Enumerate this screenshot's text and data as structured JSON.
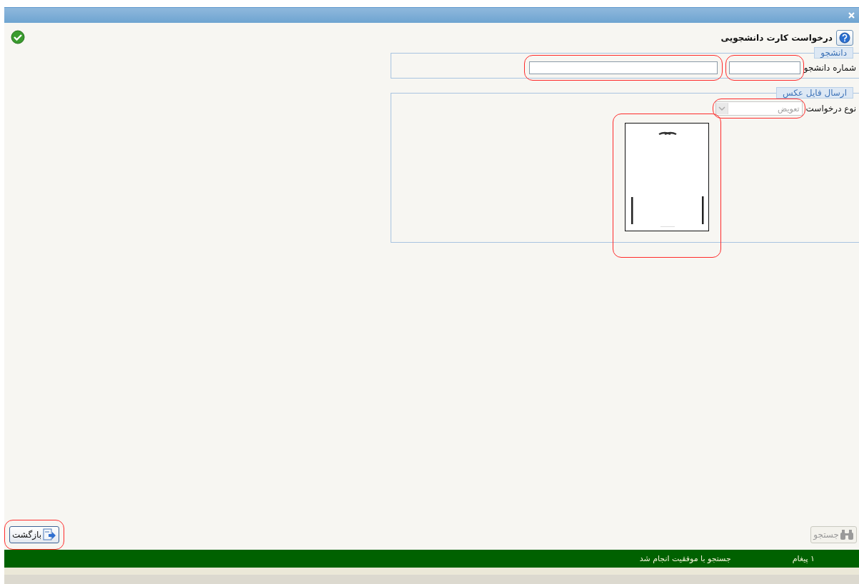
{
  "page_title": "درخواست کارت دانشجویی",
  "student_section": {
    "legend": "دانشجو",
    "label": "شماره دانشجو",
    "number_field": {
      "highlighted": true
    },
    "name_field": {
      "highlighted": true
    }
  },
  "photo_section": {
    "legend": "ارسال فایل عکس",
    "request_type": {
      "label": "نوع درخواست",
      "value": "تعویض",
      "disabled": true,
      "highlighted": true
    },
    "photo": {
      "kind": "picture",
      "highlighted": true
    }
  },
  "buttons": [
    {
      "kind": "search",
      "label": "جستجو",
      "disabled": true,
      "highlighted": false
    },
    {
      "kind": "back",
      "label": "بازگشت",
      "disabled": false,
      "highlighted": true
    }
  ],
  "status_bar": {
    "count": "۱ پیغام",
    "message": "جستجو با موفقیت انجام شد"
  }
}
